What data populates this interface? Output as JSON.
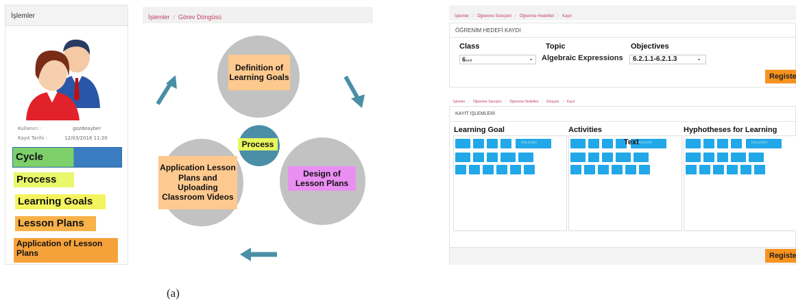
{
  "sidebar": {
    "title": "İşlemler",
    "user_label": "Kullanıcı :",
    "user_value": "gozdeayber",
    "date_label": "Kayıt Tarihi :",
    "date_value": "12/03/2018 11:20",
    "menu": [
      {
        "label": "Cycle",
        "color": "#3a7dc1"
      },
      {
        "label": "Process",
        "color": "#e9f76a"
      },
      {
        "label": "Learning Goals",
        "color": "#f4f45e"
      },
      {
        "label": "Lesson Plans",
        "color": "#f8b24a"
      },
      {
        "label": "Application of Lesson Plans",
        "color": "#f6a23a"
      }
    ]
  },
  "diagram": {
    "breadcrumb": [
      "İşlemler",
      "Görev Döngüsü"
    ],
    "nodes": {
      "top": "Definition of Learning Goals",
      "center": "Process",
      "right": "Design of Lesson Plans",
      "left": "Application Lesson Plans and Uploading Classroom Videos"
    }
  },
  "form_top": {
    "breadcrumb": [
      "İşlemler",
      "Öğrenme Süreçleri",
      "Öğrenme Hedefleri",
      "Kayıt"
    ],
    "title": "ÖĞRENİM HEDEFİ KAYDI",
    "class_label": "Class",
    "class_value": "6",
    "class_small": "sınıf",
    "topic_label": "Topic",
    "topic_value": "Algebraic Expressions",
    "objectives_label": "Objectives",
    "objectives_value": "6.2.1.1-6.2.1.3",
    "register_label": "Register"
  },
  "form_bottom": {
    "breadcrumb": [
      "İşlemler",
      "Öğrenme Süreçleri",
      "Öğrenme Hedefleri",
      "Detaylar",
      "Kayıt"
    ],
    "title": "KAYIT İŞLEMLERİ",
    "columns": [
      "Learning Goal",
      "Activities",
      "Hyphotheses for Learning"
    ],
    "text_overlay": "Text",
    "font_label": "RALEWAY",
    "register_label": "Register"
  },
  "caption": "(a)"
}
